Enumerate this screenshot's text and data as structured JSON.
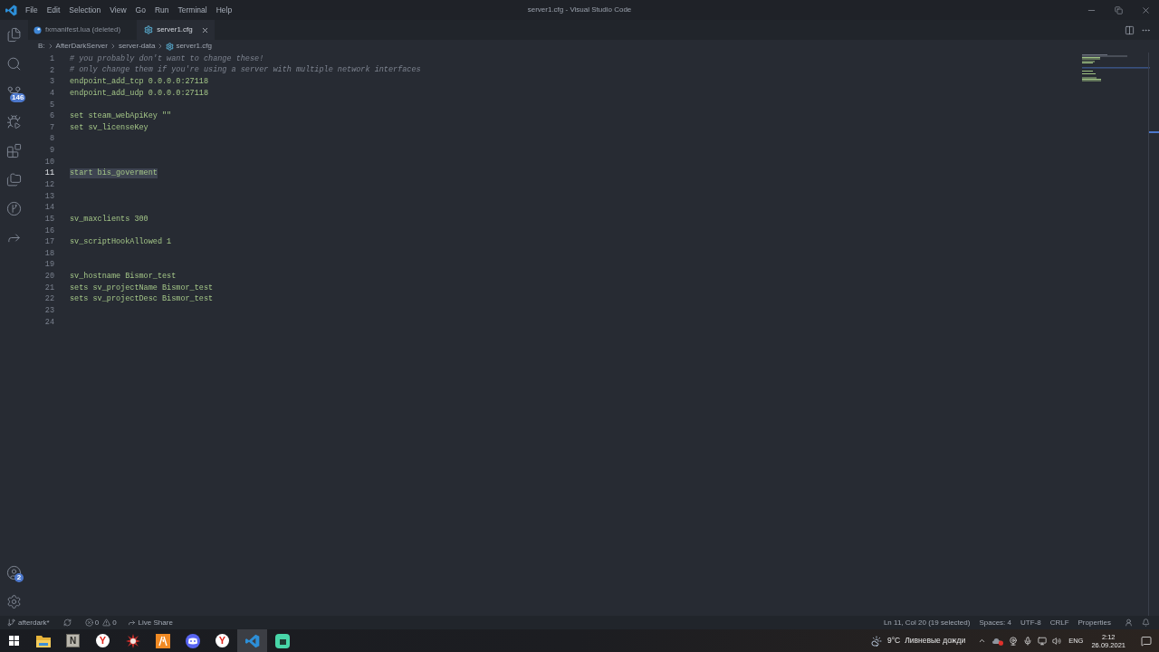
{
  "title_bar": {
    "menu": [
      "File",
      "Edit",
      "Selection",
      "View",
      "Go",
      "Run",
      "Terminal",
      "Help"
    ],
    "title": "server1.cfg - Visual Studio Code"
  },
  "activity_bar": {
    "source_control_badge": "146",
    "accounts_badge": "2"
  },
  "tabs": [
    {
      "label": "fxmanifest.lua (deleted)",
      "kind": "lua",
      "selected": false
    },
    {
      "label": "server1.cfg",
      "kind": "cfg",
      "selected": true
    }
  ],
  "breadcrumb": [
    {
      "label": "B:",
      "kind": "folder"
    },
    {
      "label": "AfterDarkServer",
      "kind": "folder"
    },
    {
      "label": "server-data",
      "kind": "folder"
    },
    {
      "label": "server1.cfg",
      "kind": "cfg"
    }
  ],
  "editor": {
    "lines": [
      {
        "number": "1",
        "kind": "comment",
        "text": "# you probably don't want to change these!",
        "selected": false
      },
      {
        "number": "2",
        "kind": "comment",
        "text": "# only change them if you're using a server with multiple network interfaces",
        "selected": false
      },
      {
        "number": "3",
        "kind": "code",
        "text": "endpoint_add_tcp 0.0.0.0:27118",
        "selected": false
      },
      {
        "number": "4",
        "kind": "code",
        "text": "endpoint_add_udp 0.0.0.0:27118",
        "selected": false
      },
      {
        "number": "5",
        "selected": false
      },
      {
        "number": "6",
        "kind": "code",
        "text": "set steam_webApiKey \"\"",
        "selected": false
      },
      {
        "number": "7",
        "kind": "code",
        "text": "set sv_licenseKey",
        "selected": false
      },
      {
        "number": "8",
        "selected": false
      },
      {
        "number": "9",
        "selected": false
      },
      {
        "number": "10",
        "selected": false
      },
      {
        "number": "11",
        "kind": "code",
        "text": "start bis_goverment",
        "selected": true
      },
      {
        "number": "12",
        "selected": false
      },
      {
        "number": "13",
        "selected": false
      },
      {
        "number": "14",
        "selected": false
      },
      {
        "number": "15",
        "kind": "code",
        "text": "sv_maxclients 300",
        "selected": false
      },
      {
        "number": "16",
        "selected": false
      },
      {
        "number": "17",
        "kind": "code",
        "text": "sv_scriptHookAllowed 1",
        "selected": false
      },
      {
        "number": "18",
        "selected": false
      },
      {
        "number": "19",
        "selected": false
      },
      {
        "number": "20",
        "kind": "code",
        "text": "sv_hostname Bismor_test",
        "selected": false
      },
      {
        "number": "21",
        "kind": "code",
        "text": "sets sv_projectName Bismor_test",
        "selected": false
      },
      {
        "number": "22",
        "kind": "code",
        "text": "sets sv_projectDesc Bismor_test",
        "selected": false
      },
      {
        "number": "23",
        "selected": false
      },
      {
        "number": "24",
        "selected": false
      }
    ]
  },
  "status_bar": {
    "branch": "afterdark*",
    "errors": "0",
    "warnings": "0",
    "live_share": "Live Share",
    "right": [
      "Ln 11, Col 20 (19 selected)",
      "Spaces: 4",
      "UTF-8",
      "CRLF",
      "Properties"
    ]
  },
  "taskbar": {
    "apps": [
      {
        "kind": "folder",
        "selected": false
      },
      {
        "kind": "letter-tile",
        "glyph": "N",
        "selected": false
      },
      {
        "kind": "letter-circle",
        "glyph": "Y",
        "selected": false
      },
      {
        "kind": "starburst",
        "selected": false
      },
      {
        "kind": "orange-tile",
        "selected": false
      },
      {
        "kind": "chat-logo",
        "selected": false
      },
      {
        "kind": "letter-circle",
        "glyph": "Y",
        "selected": false
      },
      {
        "kind": "editor",
        "selected": true
      },
      {
        "kind": "green-tile",
        "selected": false
      }
    ],
    "weather": {
      "temperature": "9°C",
      "condition": "Ливневые дожди"
    },
    "language": "ENG",
    "time": "2:12",
    "date": "26.09.2021"
  }
}
